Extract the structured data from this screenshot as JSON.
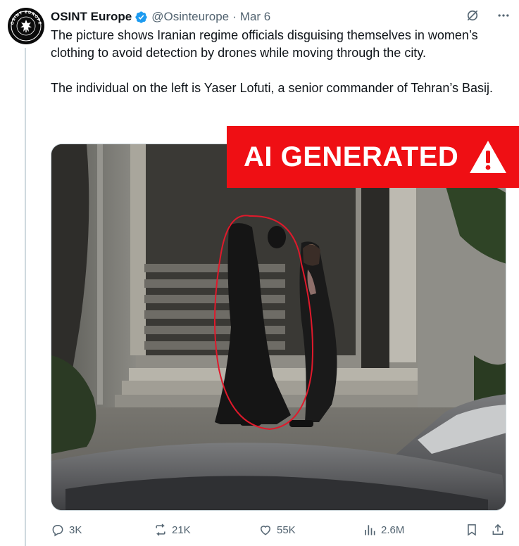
{
  "author": {
    "name": "OSINT Europe",
    "handle": "@Osinteurope",
    "separator": "·",
    "date": "Mar 6",
    "avatar_text": "OSINT EUROPE"
  },
  "tweet": {
    "paragraphs": [
      "The picture shows Iranian regime officials disguising themselves in women’s clothing to avoid detection by drones while moving through the city.",
      "The individual on the left is Yaser Lofuti, a senior commander of Tehran’s Basij."
    ]
  },
  "overlay": {
    "label": "AI GENERATED",
    "color": "#ef0f14"
  },
  "actions": {
    "replies": "3K",
    "reposts": "21K",
    "likes": "55K",
    "views": "2.6M"
  },
  "colors": {
    "verified": "#1d9bf0",
    "secondary_text": "#536471",
    "annotation_circle": "#e0192b"
  },
  "icons": [
    "grok-icon",
    "more-icon",
    "reply-icon",
    "repost-icon",
    "like-icon",
    "views-icon",
    "bookmark-icon",
    "share-icon",
    "warning-icon",
    "verified-icon"
  ]
}
